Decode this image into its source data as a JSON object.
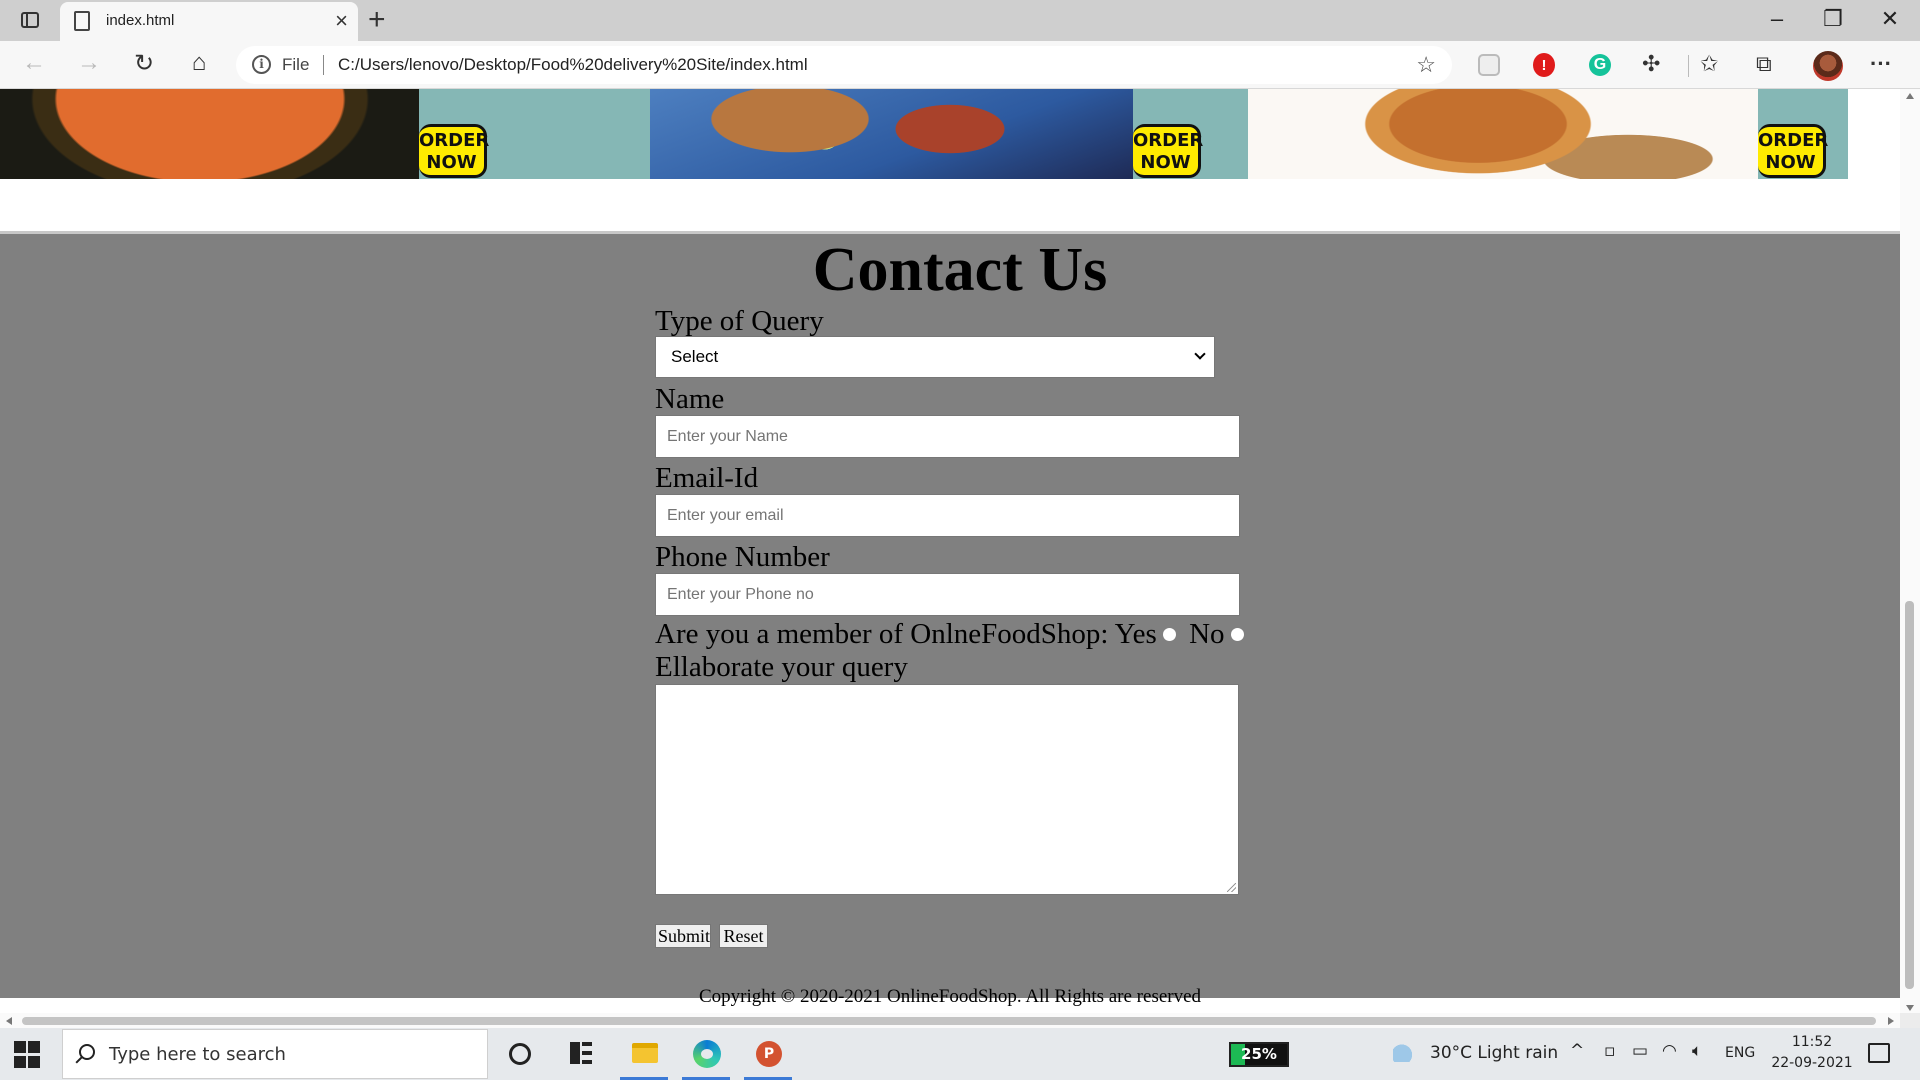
{
  "browser": {
    "tab_title": "index.html",
    "new_tab_label": "+",
    "omnibox": {
      "scheme_label": "File",
      "url": "C:/Users/lenovo/Desktop/Food%20delivery%20Site/index.html"
    },
    "icons": [
      "tab-actions-icon",
      "page-icon",
      "close-icon",
      "back-icon",
      "forward-icon",
      "refresh-icon",
      "home-icon",
      "info-icon",
      "add-favorite-icon",
      "extension-icon",
      "favorites-icon",
      "collections-icon",
      "more-icon"
    ]
  },
  "banner": {
    "order_label_line1": "ORDER",
    "order_label_line2": "NOW"
  },
  "contact": {
    "title": "Contact Us",
    "query_type_label": "Type of Query",
    "query_type_selected": "Select",
    "name_label": "Name",
    "name_placeholder": "Enter your Name",
    "email_label": "Email-Id",
    "email_placeholder": "Enter your email",
    "phone_label": "Phone Number",
    "phone_placeholder": "Enter your Phone no",
    "member_question": "Are you a member of OnlneFoodShop:",
    "member_yes": "Yes",
    "member_no": "No",
    "query_detail_label": "Ellaborate your query",
    "submit_label": "Submit",
    "reset_label": "Reset"
  },
  "footer": {
    "copyright": "Copyright © 2020-2021 OnlineFoodShop. All Rights are reserved"
  },
  "taskbar": {
    "search_placeholder": "Type here to search",
    "battery_percent": 25,
    "battery_text": "25%",
    "weather": "30°C  Light rain",
    "language": "ENG",
    "time": "11:52",
    "date": "22-09-2021",
    "apps": [
      "file-explorer",
      "microsoft-edge",
      "powerpoint"
    ]
  }
}
